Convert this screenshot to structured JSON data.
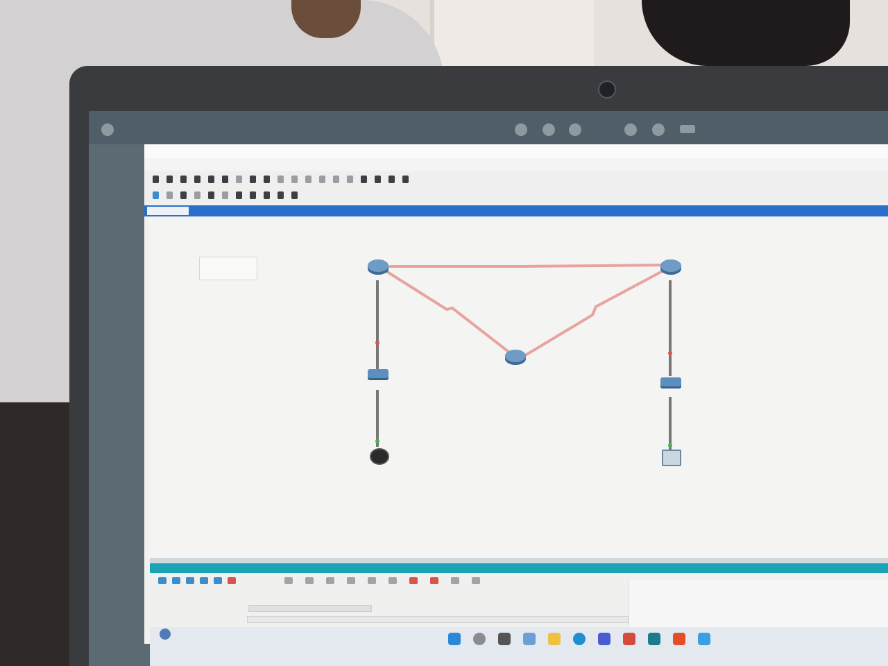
{
  "os": {
    "title": ""
  },
  "app": {
    "title": "",
    "menu": [
      "",
      "",
      "",
      "",
      "",
      "",
      ""
    ]
  },
  "workspace": {
    "tab_label": "",
    "bluebar_label": "",
    "note_lines": [
      "",
      "",
      ""
    ],
    "network_labels": [
      "",
      "",
      "",
      "",
      ""
    ],
    "devices": {
      "router_left": "",
      "router_right": "",
      "router_center": "",
      "switch_left": "",
      "switch_right": "",
      "pc_left": "",
      "pc_right": ""
    }
  },
  "colors": {
    "link_serial": "#e8a3a0",
    "link_fast": "#777777",
    "accent_blue": "#2a6fc9",
    "accent_teal": "#1aa3b4"
  }
}
